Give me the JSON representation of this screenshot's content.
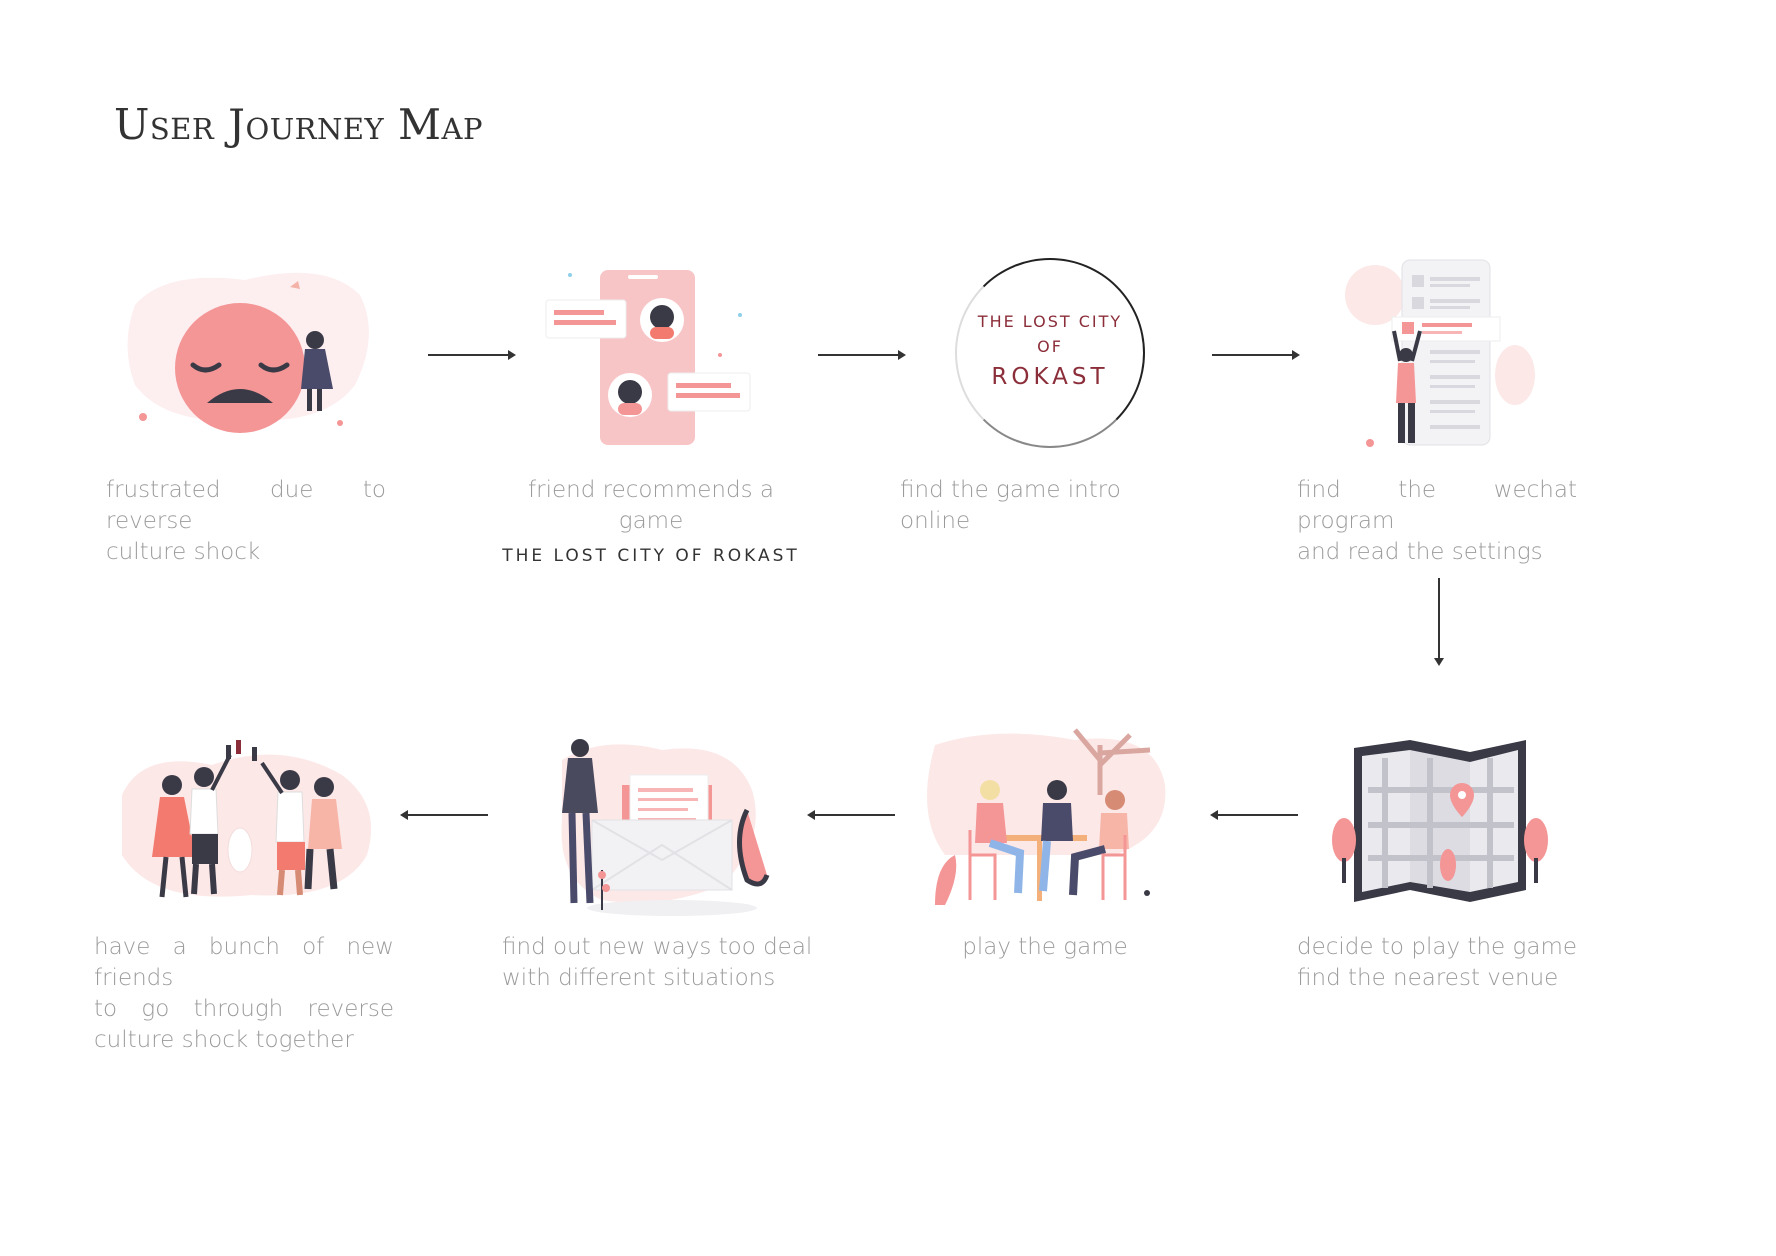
{
  "title": "User Journey Map",
  "colors": {
    "accent": "#f28b8b",
    "light_pink": "#fde8e8",
    "dark": "#3a3a47",
    "grey": "#9b9b9b",
    "maroon": "#8b2e3a"
  },
  "steps": [
    {
      "illustration": "frustrated-face-illustration",
      "lines": [
        "frustrated due to reverse",
        "culture shock"
      ]
    },
    {
      "illustration": "phone-chat-illustration",
      "lines": [
        "friend recommends a game"
      ],
      "emphasis": "THE LOST CITY OF ROKAST"
    },
    {
      "illustration": "game-logo-circle",
      "lines": [
        "find the game intro online"
      ],
      "logo": {
        "line1": "THE LOST CITY",
        "line2": "OF",
        "line3": "ROKAST"
      }
    },
    {
      "illustration": "wechat-program-illustration",
      "lines": [
        "find the wechat program",
        "and read the settings"
      ]
    },
    {
      "illustration": "folded-map-illustration",
      "lines": [
        "decide to play the game",
        "find the nearest venue"
      ]
    },
    {
      "illustration": "people-at-table-illustration",
      "lines": [
        "play the game"
      ]
    },
    {
      "illustration": "man-with-envelope-illustration",
      "lines": [
        "find out new ways too deal",
        "with different situations"
      ]
    },
    {
      "illustration": "friends-toasting-illustration",
      "lines": [
        "have a bunch of new friends",
        "to go through reverse",
        "culture shock together"
      ]
    }
  ]
}
